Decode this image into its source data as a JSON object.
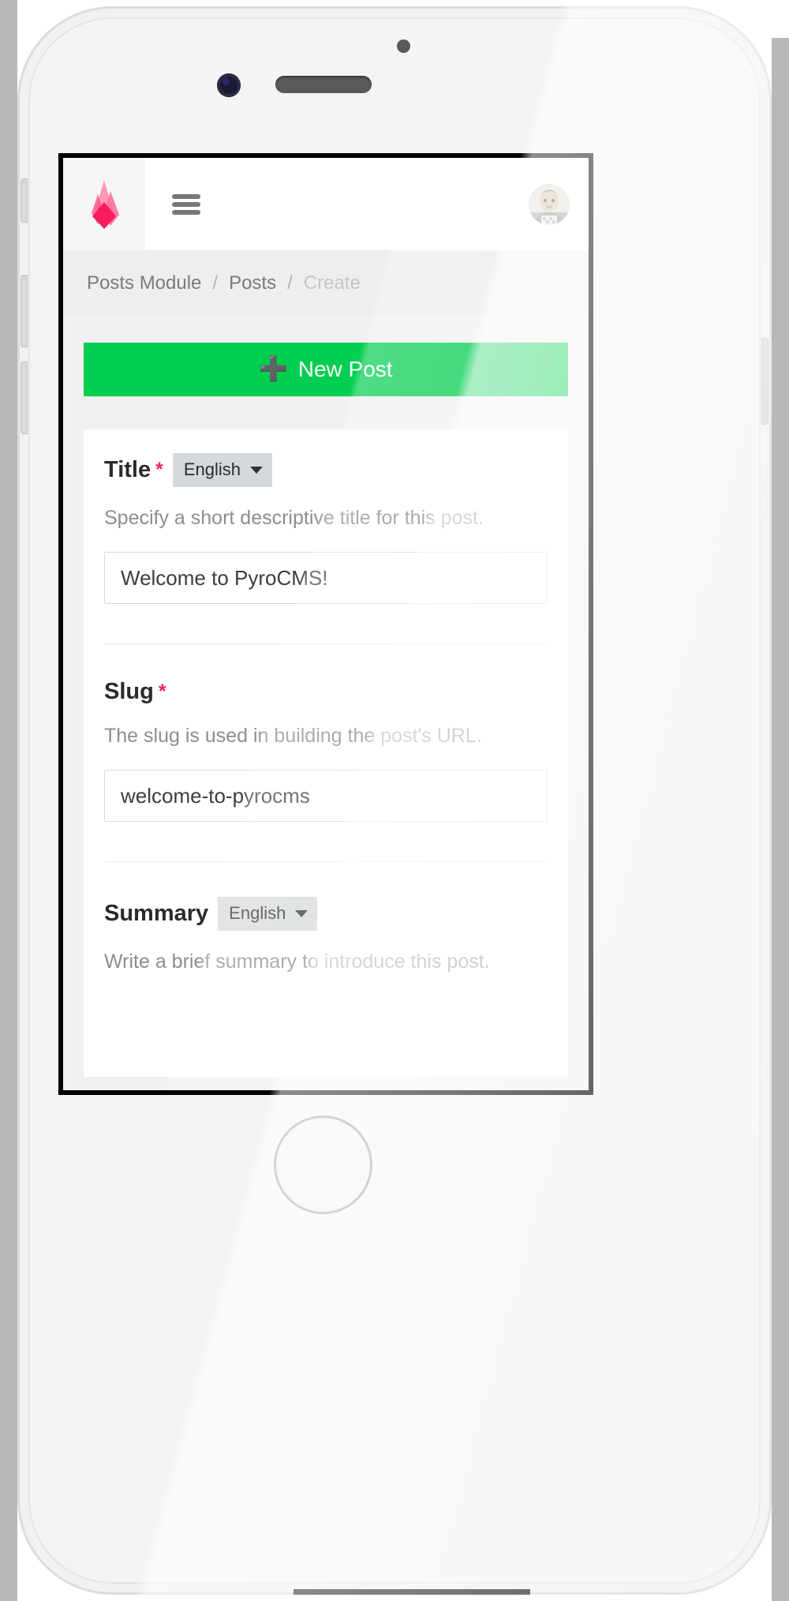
{
  "device": {
    "name": "white-smartphone-mockup",
    "hardware": {
      "earpiece": "speaker-grille",
      "front_camera": "front-camera-icon",
      "sensor": "proximity-sensor-icon",
      "home_button": "home-button"
    }
  },
  "app": {
    "brand_icon": "pyrocms-flame-logo",
    "menu_icon": "hamburger-menu-icon",
    "avatar_icon": "user-avatar"
  },
  "breadcrumb": {
    "items": [
      {
        "label": "Posts Module",
        "current": false
      },
      {
        "label": "Posts",
        "current": false
      },
      {
        "label": "Create",
        "current": true
      }
    ],
    "separator": "/"
  },
  "actions": {
    "new_post_label": "New Post",
    "new_post_icon": "plus-icon",
    "new_post_color": "#02ce4f"
  },
  "colors": {
    "accent_green": "#02ce4f",
    "required_pink": "#f2295b",
    "brand_pink": "#fb1b5f",
    "breadcrumb_bg": "#eeeeee",
    "page_bg": "#f1f1f1",
    "card_bg": "#ffffff",
    "muted_text": "#8d8d8d"
  },
  "form": {
    "fields": [
      {
        "label": "Title",
        "required": true,
        "required_mark": "*",
        "has_language": true,
        "language": "English",
        "help": "Specify a short descriptive title for this post.",
        "value": "Welcome to PyroCMS!",
        "placeholder": ""
      },
      {
        "label": "Slug",
        "required": true,
        "required_mark": "*",
        "has_language": false,
        "language": "",
        "help": "The slug is used in building the post's URL.",
        "value": "welcome-to-pyrocms",
        "placeholder": ""
      },
      {
        "label": "Summary",
        "required": false,
        "required_mark": "",
        "has_language": true,
        "language": "English",
        "help": "Write a brief summary to introduce this post.",
        "value": "",
        "placeholder": ""
      }
    ]
  }
}
